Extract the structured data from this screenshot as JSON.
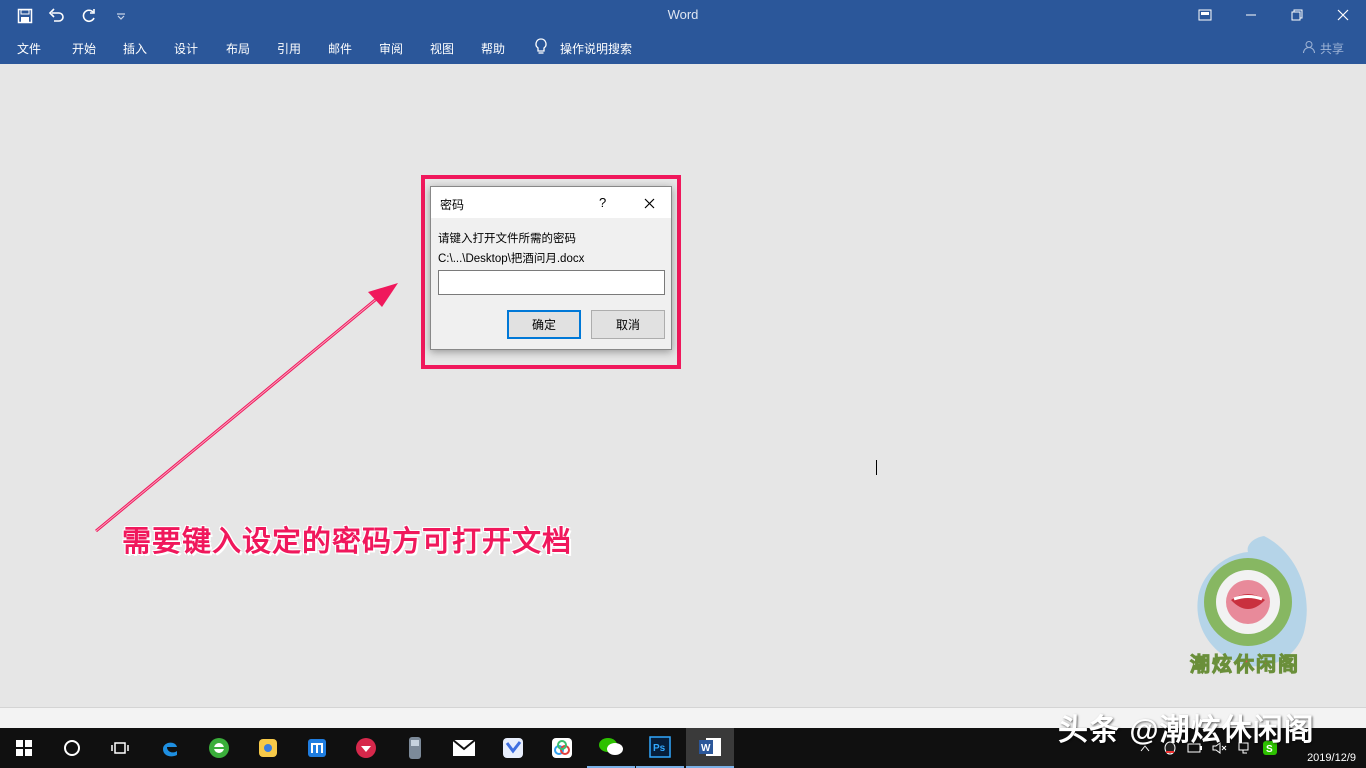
{
  "window": {
    "app_title": "Word",
    "share_label": "共享"
  },
  "ribbon_tabs": [
    "文件",
    "开始",
    "插入",
    "设计",
    "布局",
    "引用",
    "邮件",
    "审阅",
    "视图",
    "帮助",
    "操作说明搜索"
  ],
  "dialog": {
    "title": "密码",
    "help": "?",
    "prompt": "请键入打开文件所需的密码",
    "file_path": "C:\\...\\Desktop\\把酒问月.docx",
    "password_value": "",
    "ok_label": "确定",
    "cancel_label": "取消"
  },
  "annotation": {
    "caption": "需要键入设定的密码方可打开文档"
  },
  "watermark": {
    "logo_text": "潮炫休闲阁",
    "toutiao_text": "头条 @潮炫休闲阁"
  },
  "taskbar": {
    "apps": [
      "start-icon",
      "cortana-icon",
      "task-view-icon",
      "edge-icon",
      "360-browser-icon",
      "app-store-icon",
      "maxthon-icon",
      "wps-icon",
      "disk-icon",
      "mail-icon",
      "feishu-icon",
      "baidu-netdisk-icon",
      "wechat-icon",
      "photoshop-icon",
      "word-icon"
    ],
    "date": "2019/12/9"
  },
  "colors": {
    "word_blue": "#2b579a",
    "highlight": "#f0185c",
    "taskbar": "#101010"
  }
}
